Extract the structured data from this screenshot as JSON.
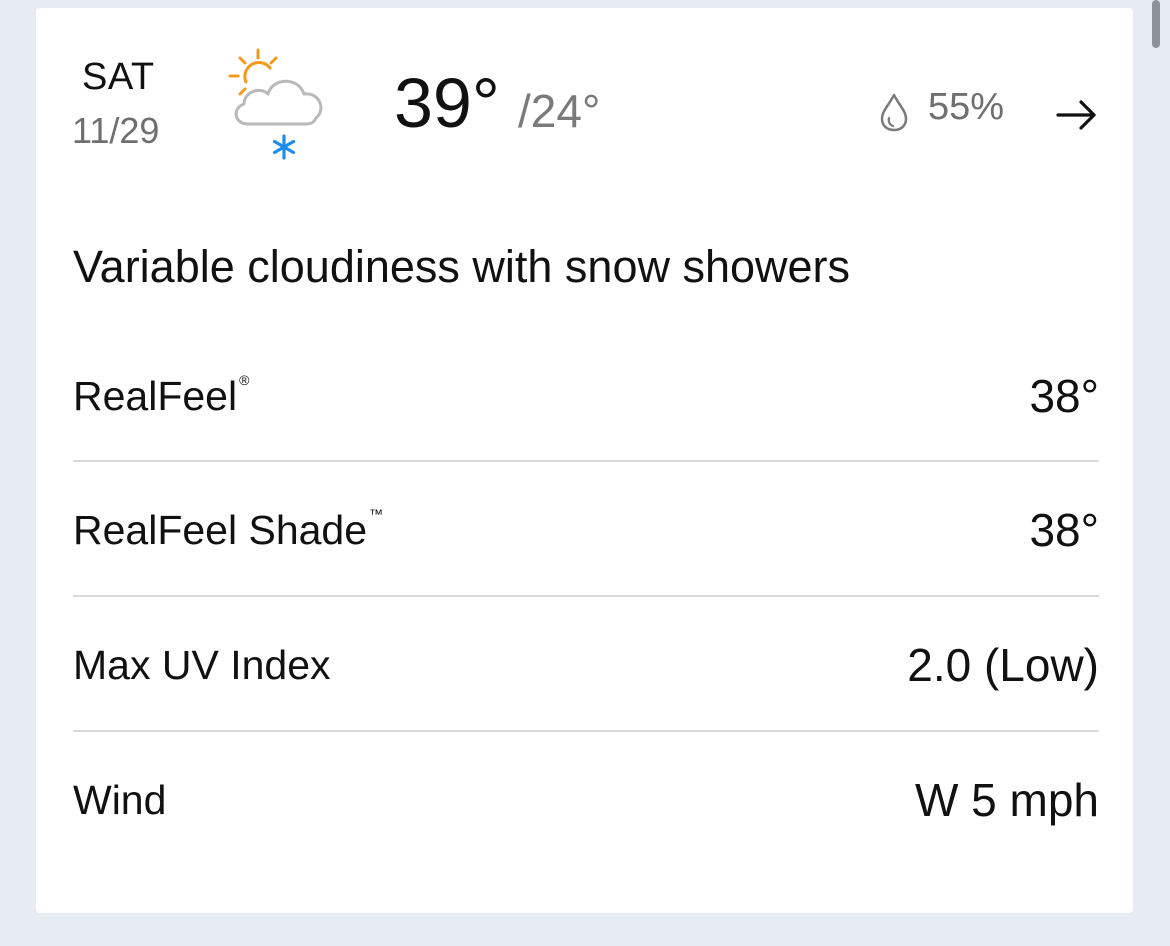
{
  "header": {
    "day": "SAT",
    "date": "11/29",
    "condition_icon": "partly-sunny-snow-icon",
    "temp_high": "39°",
    "temp_low": "/24°",
    "precip_icon": "raindrop-icon",
    "precip_chance": "55%",
    "arrow_icon": "arrow-right-icon"
  },
  "phrase": "Variable cloudiness with snow showers",
  "details": [
    {
      "label": "RealFeel",
      "mark": "®",
      "value": "38°"
    },
    {
      "label": "RealFeel Shade",
      "mark": "™",
      "value": "38°"
    },
    {
      "label": "Max UV Index",
      "mark": "",
      "value": "2.0 (Low)"
    },
    {
      "label": "Wind",
      "mark": "",
      "value": "W 5 mph"
    }
  ],
  "colors": {
    "background": "#e7ecf2",
    "card": "#ffffff",
    "sun": "#f39a1e",
    "snow": "#1e8cf0",
    "secondary_text": "#6f6f6f"
  }
}
